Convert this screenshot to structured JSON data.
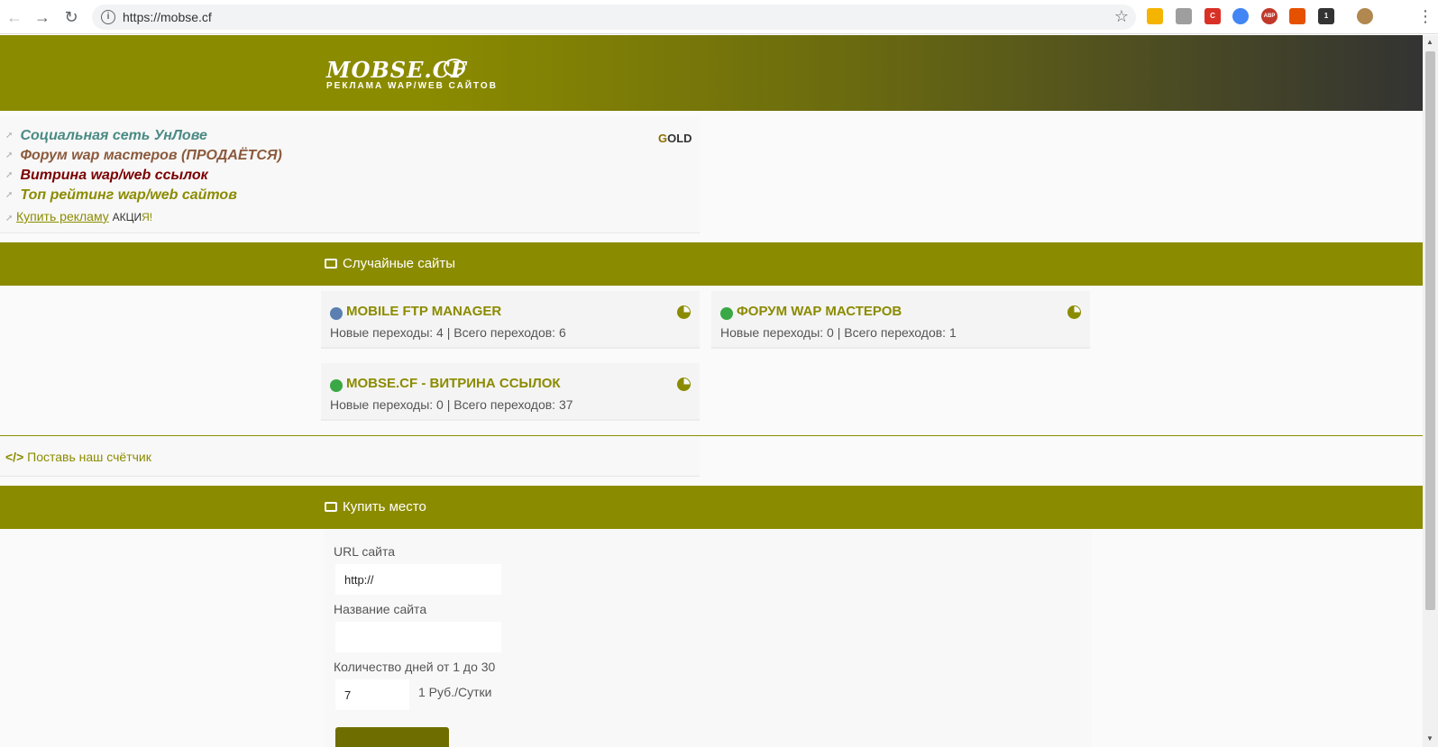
{
  "browser": {
    "url": "https://mobse.cf",
    "extensions": [
      {
        "name": "bookmark-ext",
        "color": "#f4b400"
      },
      {
        "name": "ext-gray",
        "color": "#9e9e9e"
      },
      {
        "name": "ext-red-c",
        "color": "#d93025",
        "label": "C"
      },
      {
        "name": "ext-blue",
        "color": "#4285f4"
      },
      {
        "name": "adblock-plus",
        "color": "#c0392b",
        "label": "ABP"
      },
      {
        "name": "ext-flame",
        "color": "#e65100"
      },
      {
        "name": "ext-cube",
        "color": "#333333",
        "label": "1"
      }
    ]
  },
  "logo": {
    "title": "MOBSE.CF",
    "subtitle": "РЕКЛАМА WAP/WEB САЙТОВ"
  },
  "promo": {
    "badge_g": "G",
    "badge_rest": "OLD",
    "links": [
      {
        "label": "Социальная сеть УнЛове",
        "color": "#4a8a84"
      },
      {
        "label": "Форум wap мастеров (ПРОДАЁТСЯ)",
        "color": "#8b5a3c"
      },
      {
        "label": "Витрина wap/web ссылок",
        "color": "#7a0000"
      },
      {
        "label": "Топ рейтинг wap/web сайтов",
        "color": "#8b8b00"
      }
    ],
    "buy_ad": "Купить рекламу",
    "action_1": "АКЦИ",
    "action_2": "Я!"
  },
  "random_sites": {
    "title": "Случайные сайты",
    "items": [
      {
        "name": "MOBILE FTP MANAGER",
        "stats": "Новые переходы: 4 | Всего переходов: 6",
        "favicon_color": "#5a7fb0"
      },
      {
        "name": "ФОРУМ WAP МАСТЕРОВ",
        "stats": "Новые переходы: 0 | Всего переходов: 1",
        "favicon_color": "#3aa845"
      },
      {
        "name": "MOBSE.CF - ВИТРИНА ССЫЛОК",
        "stats": "Новые переходы: 0 | Всего переходов: 37",
        "favicon_color": "#3aa845"
      }
    ]
  },
  "counter": {
    "label": "Поставь наш счётчик"
  },
  "buy_place": {
    "title": "Купить место",
    "url_label": "URL сайта",
    "url_value": "http://",
    "name_label": "Название сайта",
    "name_value": "",
    "days_label": "Количество дней от 1 до 30",
    "days_value": "7",
    "price": "1 Руб./Сутки"
  }
}
